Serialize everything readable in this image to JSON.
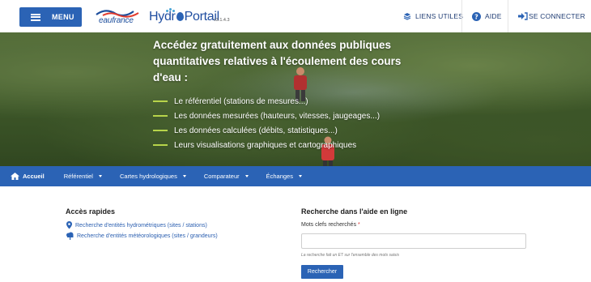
{
  "header": {
    "menu_label": "MENU",
    "eaufrance_logo_text": "eaufrance",
    "hydroportail_logo": {
      "part1": "Hydr",
      "part2": "Portail"
    },
    "version": "v3.1.4.3",
    "links": [
      {
        "label": "LIENS UTILES",
        "icon": "links-icon"
      },
      {
        "label": "AIDE",
        "icon": "help-icon"
      },
      {
        "label": "SE CONNECTER",
        "icon": "login-icon"
      }
    ]
  },
  "hero": {
    "title": "Accédez gratuitement aux données publiques quantitatives relatives à l'écoulement des cours d'eau :",
    "items": [
      "Le référentiel (stations de mesures...)",
      "Les données mesurées (hauteurs, vitesses, jaugeages...)",
      "Les données calculées (débits, statistiques...)",
      "Leurs visualisations graphiques et cartographiques"
    ]
  },
  "nav": {
    "home": "Accueil",
    "items": [
      "Référentiel",
      "Cartes hydrologiques",
      "Comparateur",
      "Échanges"
    ]
  },
  "quick_access": {
    "title": "Accès rapides",
    "links": [
      "Recherche d'entités hydrométriques (sites / stations)",
      "Recherche d'entités météorologiques (sites / grandeurs)"
    ]
  },
  "help_search": {
    "title": "Recherche dans l'aide en ligne",
    "field_label": "Mots clefs recherchés",
    "required_mark": "*",
    "input_value": "",
    "hint": "La recherche fait un ET sur l'ensemble des mots saisis",
    "button_label": "Rechercher"
  },
  "colors": {
    "primary": "#2b63b5",
    "accent_green": "#b7d44a",
    "link": "#2b5fb0"
  }
}
